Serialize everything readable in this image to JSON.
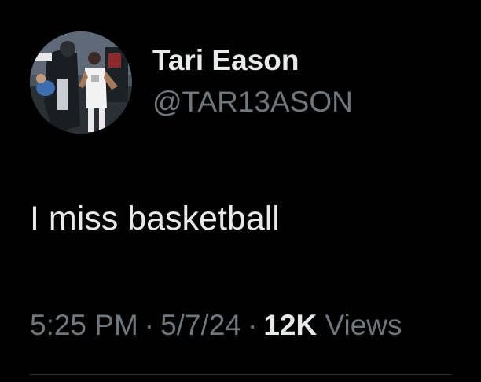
{
  "author": {
    "display_name": "Tari Eason",
    "handle": "@TAR13ASON",
    "avatar": "profile-photo-basketball"
  },
  "tweet": {
    "text": "I miss basketball"
  },
  "meta": {
    "time": "5:25 PM",
    "separator": "·",
    "date": "5/7/24",
    "views_count": "12K",
    "views_label": "Views"
  },
  "colors": {
    "background": "#000000",
    "primary_text": "#e7e9ea",
    "secondary_text": "#71767b"
  }
}
